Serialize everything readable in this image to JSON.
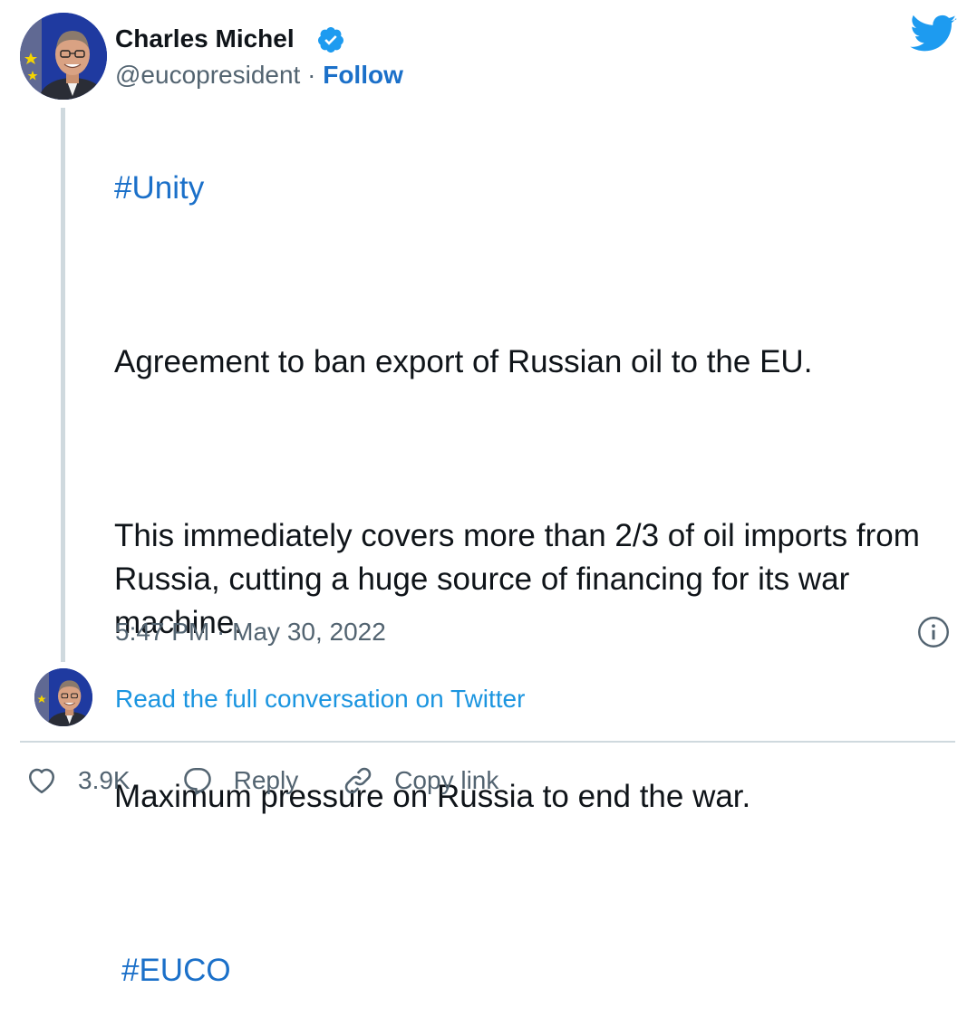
{
  "author": {
    "name": "Charles Michel",
    "handle": "@eucopresident",
    "separator": " · ",
    "follow_label": "Follow",
    "verified": true
  },
  "tweet": {
    "hashtag_top": "#Unity",
    "paragraph_1": "Agreement to ban export of Russian oil to the EU.",
    "paragraph_2": "This immediately covers more than 2/3 of oil imports from Russia, cutting a huge source of financing for its war machine.",
    "paragraph_3": "Maximum pressure on Russia to end the war.",
    "hashtag_bottom": "#EUCO"
  },
  "timestamp": "5:47 PM · May 30, 2022",
  "read_full_label": "Read the full conversation on Twitter",
  "actions": {
    "like_count": "3.9K",
    "reply_label": "Reply",
    "copy_link_label": "Copy link"
  },
  "icons": {
    "verified": "verified-badge-icon",
    "twitter": "twitter-bird-icon",
    "info": "info-icon",
    "like": "heart-icon",
    "reply": "speech-bubble-icon",
    "copy": "link-icon"
  },
  "colors": {
    "link": "#1b70c9",
    "read_full": "#1b95e0",
    "twitter_blue": "#1d9bf0",
    "muted": "#536471",
    "divider": "#cfd9de"
  }
}
